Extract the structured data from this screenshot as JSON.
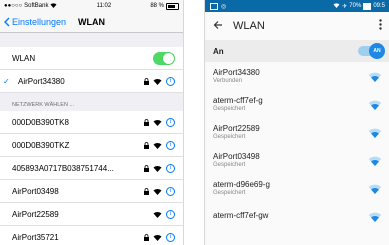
{
  "ios": {
    "status": {
      "carrier": "SoftBank",
      "time": "11:02",
      "battery": "88 %"
    },
    "back_label": "Einstellungen",
    "title": "WLAN",
    "wlan_label": "WLAN",
    "connected_network": "AirPort34380",
    "section_header": "NETZWERK WÄHLEN ...",
    "networks": [
      {
        "name": "000D0B390TK8",
        "locked": true
      },
      {
        "name": "000D0B390TKZ",
        "locked": true
      },
      {
        "name": "405893A0717B038751744...",
        "locked": true
      },
      {
        "name": "AirPort03498",
        "locked": true
      },
      {
        "name": "AirPort22589",
        "locked": false
      },
      {
        "name": "AirPort35721",
        "locked": true
      }
    ],
    "accent": "#007aff"
  },
  "android": {
    "status": {
      "wifi": "70%",
      "time": "09:5"
    },
    "title": "WLAN",
    "master_label": "An",
    "switch_text": "AN",
    "networks": [
      {
        "name": "AirPort34380",
        "status": "Verbunden"
      },
      {
        "name": "aterm-cff7ef-g",
        "status": "Gespeichert"
      },
      {
        "name": "AirPort22589",
        "status": "Gespeichert"
      },
      {
        "name": "AirPort03498",
        "status": "Gespeichert"
      },
      {
        "name": "aterm-d96e69-g",
        "status": "Gespeichert"
      },
      {
        "name": "aterm-cff7ef-gw",
        "status": ""
      }
    ],
    "accent": "#1e88e5",
    "statusbar_color": "#0a6aa8"
  }
}
